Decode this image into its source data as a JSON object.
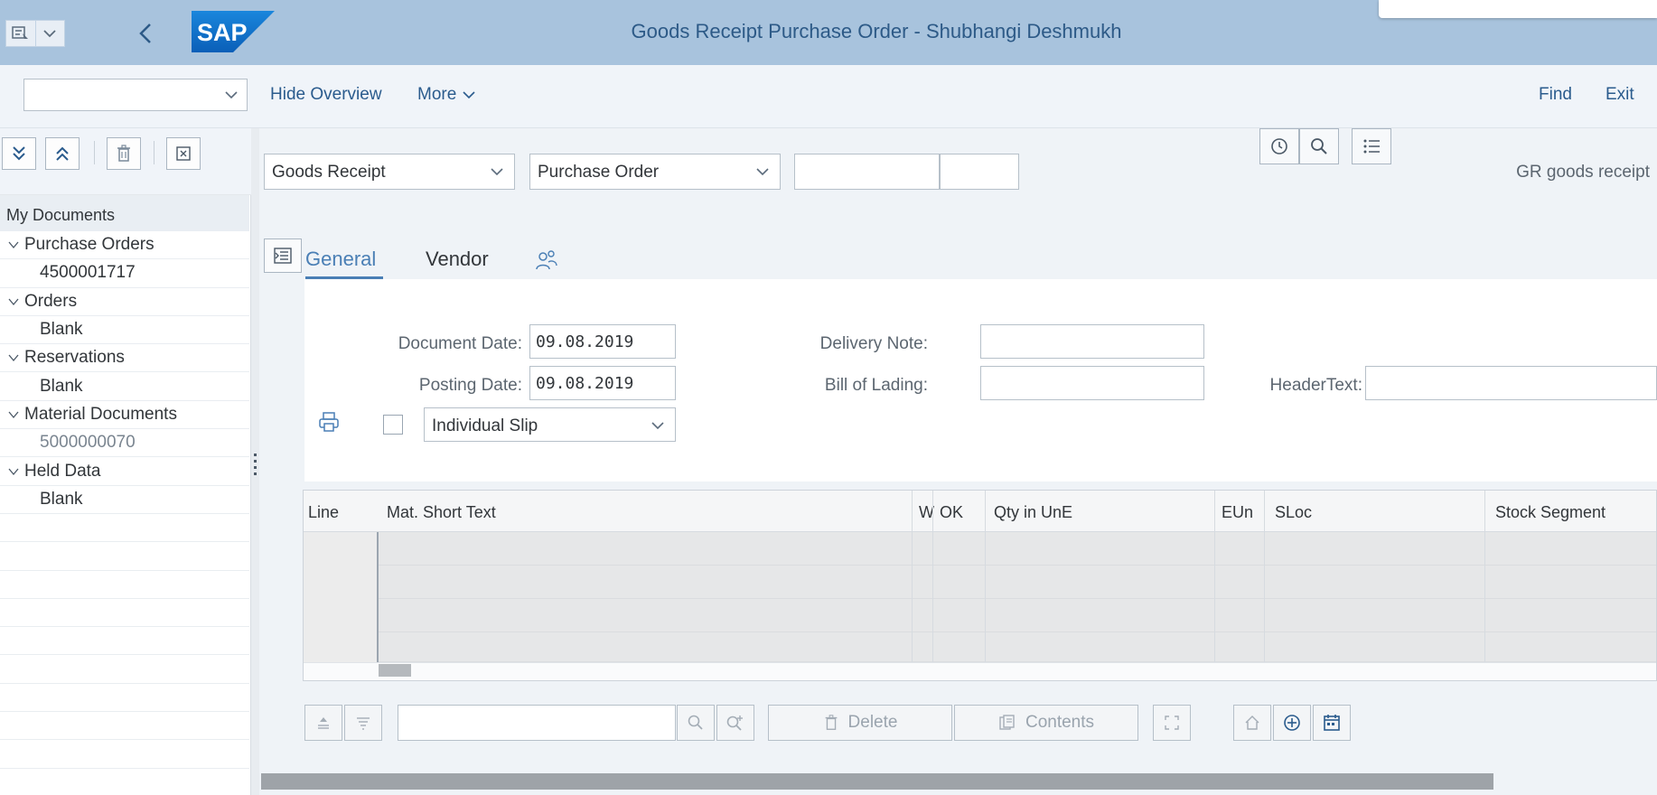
{
  "shell": {
    "title": "Goods Receipt Purchase Order - Shubhangi Deshmukh",
    "logo_text": "SAP",
    "brand_color": "#0a6ed1"
  },
  "toolbar": {
    "hide_overview": "Hide Overview",
    "more": "More",
    "find": "Find",
    "exit": "Exit"
  },
  "left": {
    "header": "My Documents",
    "tree": [
      {
        "label": "Purchase Orders",
        "child": "4500001717",
        "muted": false
      },
      {
        "label": "Orders",
        "child": "Blank",
        "muted": false
      },
      {
        "label": "Reservations",
        "child": "Blank",
        "muted": false
      },
      {
        "label": "Material Documents",
        "child": "5000000070",
        "muted": true
      },
      {
        "label": "Held Data",
        "child": "Blank",
        "muted": false
      }
    ]
  },
  "main": {
    "transaction": "Goods Receipt",
    "reference": "Purchase Order",
    "gr_label": "GR goods receipt",
    "tabs": {
      "general": "General",
      "vendor": "Vendor"
    },
    "general": {
      "doc_date_label": "Document Date:",
      "doc_date": "09.08.2019",
      "posting_date_label": "Posting Date:",
      "posting_date": "09.08.2019",
      "delivery_note_label": "Delivery Note:",
      "bill_of_lading_label": "Bill of Lading:",
      "header_text_label": "HeaderText:",
      "slip": "Individual Slip"
    },
    "table": {
      "columns": [
        "Line",
        "Mat. Short Text",
        "W",
        "OK",
        "Qty in UnE",
        "EUn",
        "SLoc",
        "Stock Segment"
      ]
    },
    "bottom": {
      "delete": "Delete",
      "contents": "Contents"
    }
  }
}
